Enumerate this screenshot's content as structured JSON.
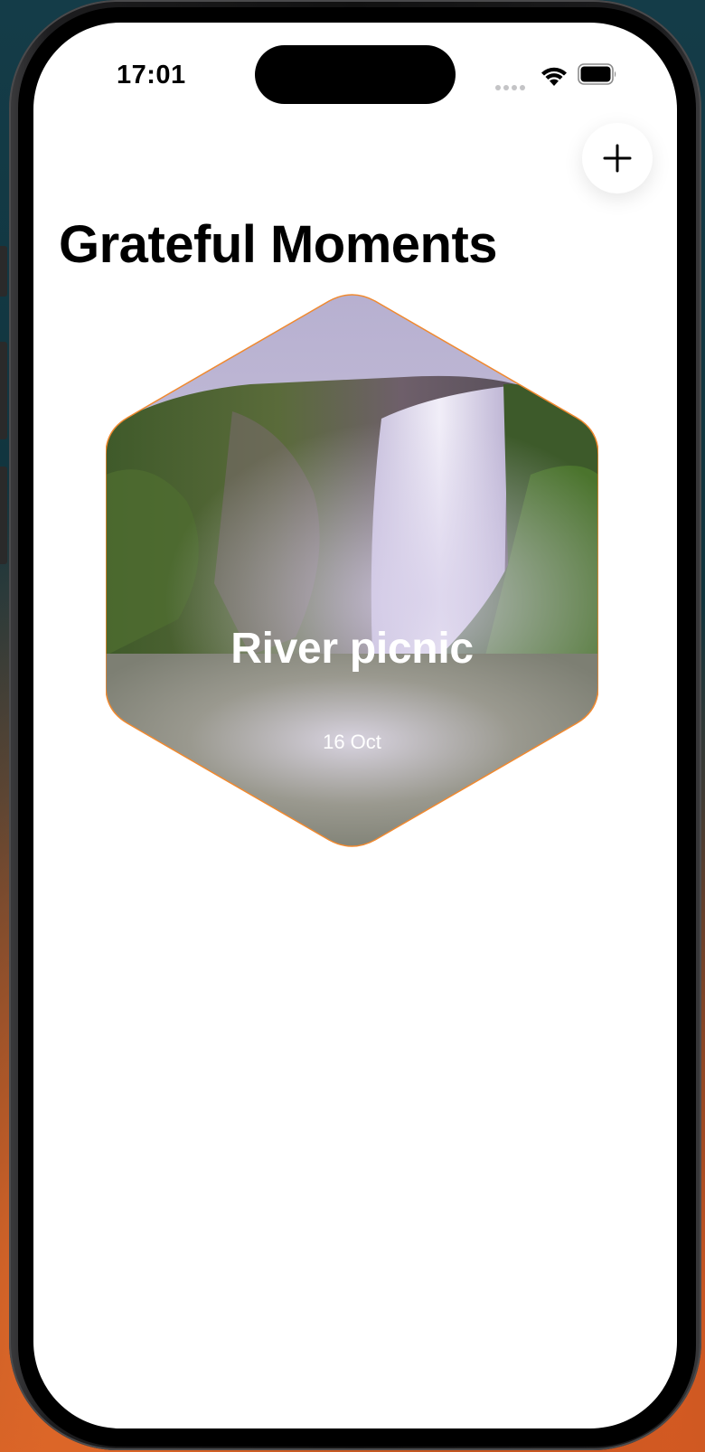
{
  "status_bar": {
    "time": "17:01"
  },
  "toolbar": {
    "add_icon": "plus-icon"
  },
  "page": {
    "title": "Grateful Moments"
  },
  "moments": [
    {
      "title": "River picnic",
      "date": "16 Oct",
      "image": "waterfall-photo"
    }
  ],
  "colors": {
    "card_border": "#f0892f",
    "card_overlay": "#8e8e86",
    "background": "#ffffff",
    "text_primary": "#000000"
  }
}
